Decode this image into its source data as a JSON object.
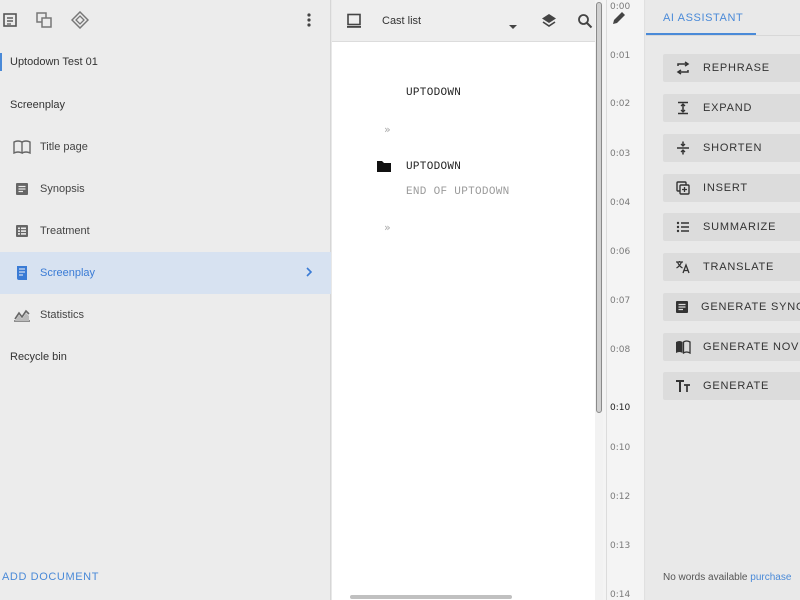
{
  "sidebar": {
    "toolbar": {
      "icons": [
        "document-icon",
        "duplicate-icon",
        "diamond-icon",
        "more-vert-icon"
      ]
    },
    "project_name": "Uptodown Test 01",
    "section_title": "Screenplay",
    "items": [
      {
        "label": "Title page",
        "icon": "book-icon"
      },
      {
        "label": "Synopsis",
        "icon": "note-icon"
      },
      {
        "label": "Treatment",
        "icon": "list-icon"
      },
      {
        "label": "Screenplay",
        "icon": "script-icon",
        "active": true
      },
      {
        "label": "Statistics",
        "icon": "chart-icon"
      }
    ],
    "recycle_bin": "Recycle bin",
    "add_document": "ADD DOCUMENT"
  },
  "editor": {
    "cast_list": "Cast list",
    "lines": [
      {
        "text": "UPTODOWN",
        "style": "normal"
      },
      {
        "text": "»",
        "style": "marker"
      },
      {
        "text": "UPTODOWN",
        "style": "normal"
      },
      {
        "text": "END OF UPTODOWN",
        "style": "muted"
      },
      {
        "text": "»",
        "style": "marker"
      }
    ]
  },
  "timeline": {
    "ticks": [
      "0:00",
      "0:01",
      "0:02",
      "0:03",
      "0:04",
      "0:06",
      "0:07",
      "0:08",
      "0:10",
      "0:10",
      "0:12",
      "0:13",
      "0:14"
    ],
    "current": "0:10"
  },
  "ai_assistant": {
    "tab": "AI ASSISTANT",
    "actions": [
      {
        "label": "REPHRASE",
        "icon": "swap-icon"
      },
      {
        "label": "EXPAND",
        "icon": "expand-icon"
      },
      {
        "label": "SHORTEN",
        "icon": "shorten-icon"
      },
      {
        "label": "INSERT",
        "icon": "insert-icon"
      },
      {
        "label": "SUMMARIZE",
        "icon": "list-icon"
      },
      {
        "label": "TRANSLATE",
        "icon": "translate-icon"
      },
      {
        "label": "GENERATE SYNOPSIS",
        "icon": "note-icon"
      },
      {
        "label": "GENERATE NOVEL",
        "icon": "book-open-icon"
      },
      {
        "label": "GENERATE",
        "icon": "text-size-icon"
      }
    ],
    "footer": {
      "words": "No words available",
      "link": "purchase"
    }
  },
  "colors": {
    "accent": "#4a8ad8",
    "active_bg": "#d7e2f1",
    "sidebar_bg": "#ececec",
    "editor_bg": "#ffffff"
  }
}
